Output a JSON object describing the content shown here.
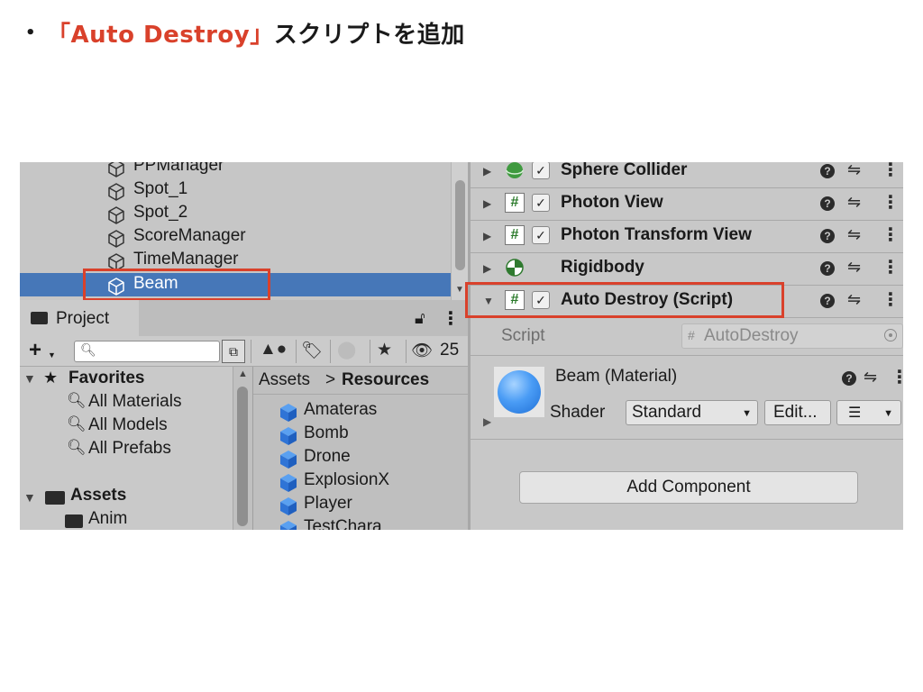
{
  "heading": {
    "bullet": "•",
    "accent": "「Auto Destroy」",
    "rest": "スクリプトを追加"
  },
  "colors": {
    "accent_red": "#d9412b",
    "selection_blue": "#4677b8",
    "material_blue": "#4a9cf5"
  },
  "hierarchy": {
    "items": [
      {
        "label": "PPManager",
        "icon": "gameobject-cube-icon",
        "selected": false
      },
      {
        "label": "Spot_1",
        "icon": "gameobject-cube-icon",
        "selected": false
      },
      {
        "label": "Spot_2",
        "icon": "gameobject-cube-icon",
        "selected": false
      },
      {
        "label": "ScoreManager",
        "icon": "gameobject-cube-icon",
        "selected": false
      },
      {
        "label": "TimeManager",
        "icon": "gameobject-cube-icon",
        "selected": false
      },
      {
        "label": "Beam",
        "icon": "gameobject-cube-icon",
        "selected": true
      }
    ]
  },
  "project": {
    "tab_label": "Project",
    "add_label": "+",
    "search_placeholder": "",
    "hidden_count": "25",
    "favorites": {
      "label": "Favorites",
      "items": [
        "All Materials",
        "All Models",
        "All Prefabs"
      ]
    },
    "assets_label": "Assets",
    "asset_folders": [
      "Anim"
    ],
    "breadcrumb": {
      "root": "Assets",
      "separator": ">",
      "current": "Resources"
    },
    "prefabs": [
      "Amateras",
      "Bomb",
      "Drone",
      "ExplosionX",
      "Player",
      "TestChara"
    ]
  },
  "inspector": {
    "components": [
      {
        "name": "Sphere Collider",
        "icon": "sphere-collider-icon",
        "checked": true
      },
      {
        "name": "Photon View",
        "icon": "script-hash-icon",
        "checked": true
      },
      {
        "name": "Photon Transform View",
        "icon": "script-hash-icon",
        "checked": true
      },
      {
        "name": "Rigidbody",
        "icon": "rigidbody-icon",
        "checked": null
      },
      {
        "name": "Auto Destroy (Script)",
        "icon": "script-hash-icon",
        "checked": true,
        "expanded": true
      }
    ],
    "script_field": {
      "label": "Script",
      "value": "AutoDestroy"
    },
    "material": {
      "name": "Beam (Material)",
      "shader_label": "Shader",
      "shader_value": "Standard",
      "edit_label": "Edit..."
    },
    "add_component_label": "Add Component"
  }
}
